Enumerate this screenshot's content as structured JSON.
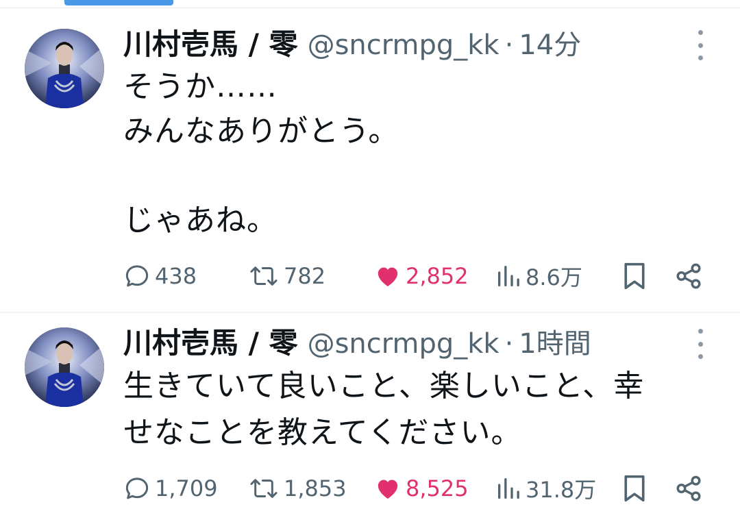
{
  "tweets": [
    {
      "author": {
        "name": "川村壱馬 / 零",
        "handle": "@sncrmpg_kk"
      },
      "separator": "·",
      "time": "14分",
      "text": "そうか……\nみんなありがとう。\n\nじゃあね。",
      "stats": {
        "replies": "438",
        "retweets": "782",
        "likes": "2,852",
        "views": "8.6万"
      },
      "liked": true
    },
    {
      "author": {
        "name": "川村壱馬 / 零",
        "handle": "@sncrmpg_kk"
      },
      "separator": "·",
      "time": "1時間",
      "text": "生きていて良いこと、楽しいこと、幸\nせなことを教えてください。",
      "stats": {
        "replies": "1,709",
        "retweets": "1,853",
        "likes": "8,525",
        "views": "31.8万"
      },
      "liked": true
    }
  ],
  "colors": {
    "like": "#e0316e",
    "muted": "#536471",
    "text": "#0f1419",
    "accent": "#4a99e9"
  }
}
